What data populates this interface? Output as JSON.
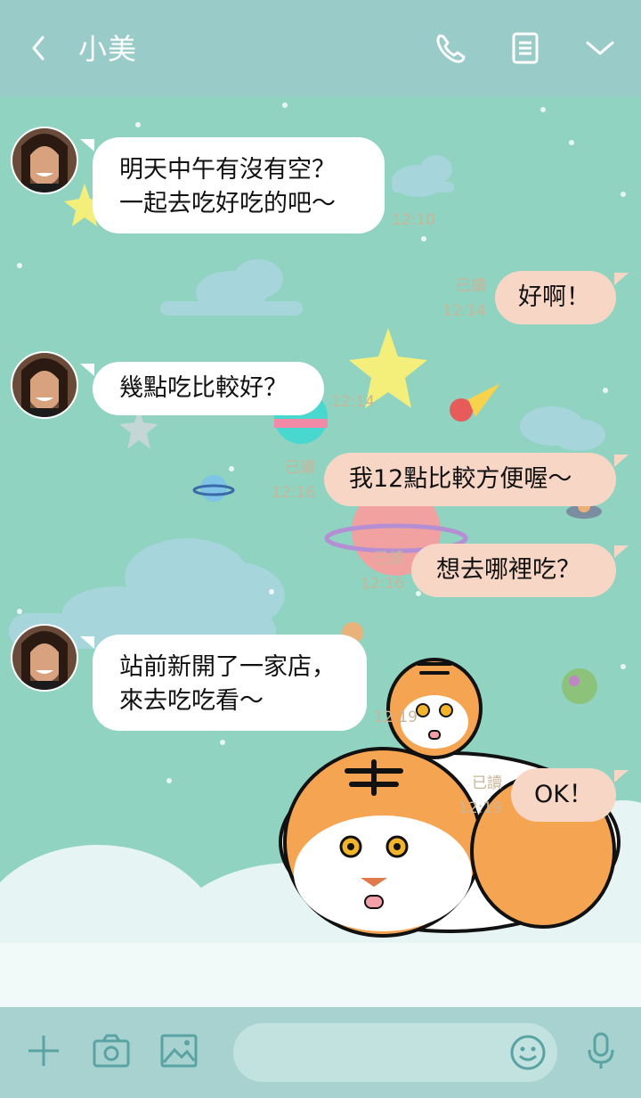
{
  "header": {
    "title": "小美",
    "icons": [
      "back-chevron-icon",
      "phone-icon",
      "notes-icon",
      "chevron-down-icon"
    ]
  },
  "messages": [
    {
      "direction": "in",
      "lines": [
        "明天中午有沒有空？",
        "一起去吃好吃的吧～"
      ],
      "time": "12:10"
    },
    {
      "direction": "out",
      "lines": [
        "好啊！"
      ],
      "read": "已讀",
      "time": "12:14"
    },
    {
      "direction": "in",
      "lines": [
        "幾點吃比較好？"
      ],
      "time": "12:14"
    },
    {
      "direction": "out",
      "lines": [
        "我12點比較方便喔～"
      ],
      "read": "已讀",
      "time": "12:16"
    },
    {
      "direction": "out",
      "lines": [
        "想去哪裡吃？"
      ],
      "read": "已讀",
      "time": "12:16"
    },
    {
      "direction": "in",
      "lines": [
        "站前新開了一家店，",
        "來去吃吃看～"
      ],
      "time": "12:19"
    },
    {
      "direction": "out",
      "lines": [
        "OK！"
      ],
      "read": "已讀",
      "time": "12:19"
    }
  ],
  "footer": {
    "icons": [
      "plus-icon",
      "camera-icon",
      "image-icon",
      "emoji-icon",
      "microphone-icon"
    ],
    "input_value": ""
  },
  "colors": {
    "header": "#99cbc9",
    "background": "#8fd3c0",
    "incoming_bubble": "#ffffff",
    "outgoing_bubble": "#f8d6c6",
    "timestamp": "#c9b59a",
    "footer": "#a8d2cf"
  }
}
